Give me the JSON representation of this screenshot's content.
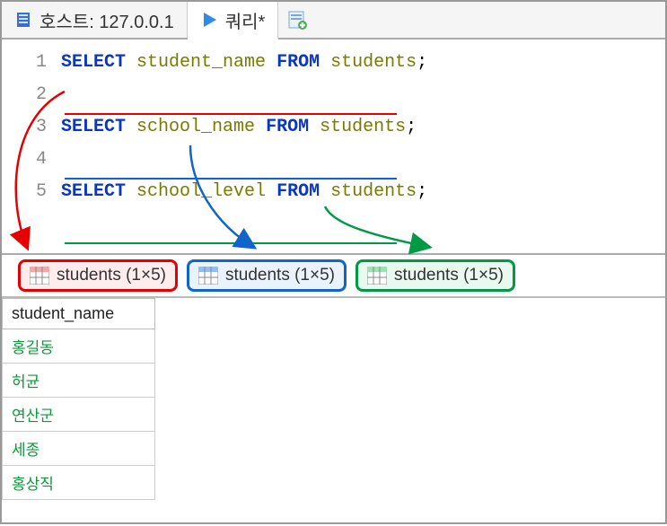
{
  "top_tabs": {
    "host_label": "호스트: 127.0.0.1",
    "query_label": "쿼리*"
  },
  "editor": {
    "lines": [
      {
        "num": "1",
        "tokens": [
          [
            "kw",
            "SELECT"
          ],
          [
            "sp",
            " "
          ],
          [
            "ident",
            "student_name"
          ],
          [
            "sp",
            " "
          ],
          [
            "kw",
            "FROM"
          ],
          [
            "sp",
            " "
          ],
          [
            "ident",
            "students"
          ],
          [
            "punct",
            ";"
          ]
        ]
      },
      {
        "num": "2",
        "tokens": []
      },
      {
        "num": "3",
        "tokens": [
          [
            "kw",
            "SELECT"
          ],
          [
            "sp",
            " "
          ],
          [
            "ident",
            "school_name"
          ],
          [
            "sp",
            " "
          ],
          [
            "kw",
            "FROM"
          ],
          [
            "sp",
            " "
          ],
          [
            "ident",
            "students"
          ],
          [
            "punct",
            ";"
          ]
        ]
      },
      {
        "num": "4",
        "tokens": []
      },
      {
        "num": "5",
        "tokens": [
          [
            "kw",
            "SELECT"
          ],
          [
            "sp",
            " "
          ],
          [
            "ident",
            "school_level"
          ],
          [
            "sp",
            " "
          ],
          [
            "kw",
            "FROM"
          ],
          [
            "sp",
            " "
          ],
          [
            "ident",
            "students"
          ],
          [
            "punct",
            ";"
          ]
        ]
      }
    ]
  },
  "result_tabs": [
    {
      "label": "students (1×5)",
      "color": "red"
    },
    {
      "label": "students (1×5)",
      "color": "blue"
    },
    {
      "label": "students (1×5)",
      "color": "green"
    }
  ],
  "result": {
    "column": "student_name",
    "rows": [
      "홍길동",
      "허균",
      "연산군",
      "세종",
      "홍상직"
    ]
  }
}
